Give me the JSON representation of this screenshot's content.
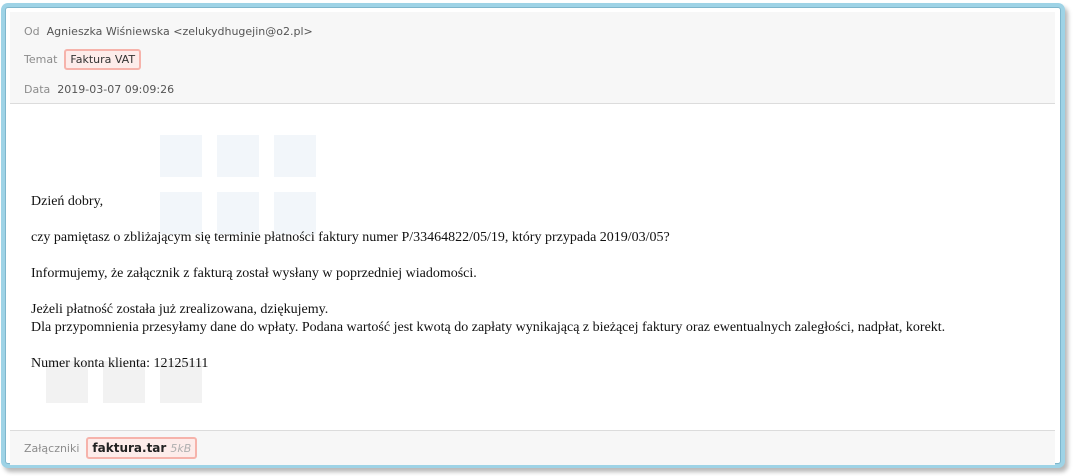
{
  "header": {
    "from_label": "Od",
    "from_value": "Agnieszka Wiśniewska <zelukydhugejin@o2.pl>",
    "subject_label": "Temat",
    "subject_value": "Faktura VAT",
    "date_label": "Data",
    "date_value": "2019-03-07 09:09:26"
  },
  "message": {
    "greeting": "Dzień dobry,",
    "p1": "czy pamiętasz o zbliżającym się terminie płatności faktury numer P/33464822/05/19, który przypada 2019/03/05?",
    "p2": "Informujemy, że załącznik z fakturą został wysłany w poprzedniej wiadomości.",
    "p3_line1": "Jeżeli płatność została już zrealizowana, dziękujemy.",
    "p3_line2": "Dla przypomnienia przesyłamy dane do wpłaty. Podana wartość jest kwotą do zapłaty wynikającą z bieżącej faktury oraz ewentualnych zaległości, nadpłat, korekt.",
    "account": "Numer konta klienta: 12125111"
  },
  "footer": {
    "attachments_label": "Załączniki",
    "attachment_name": "faktura.tar",
    "attachment_size": "5kB"
  },
  "colors": {
    "frame_accent": "#9ed3e6",
    "badge_border": "#f6b3ab",
    "badge_bg": "#fdecea"
  }
}
